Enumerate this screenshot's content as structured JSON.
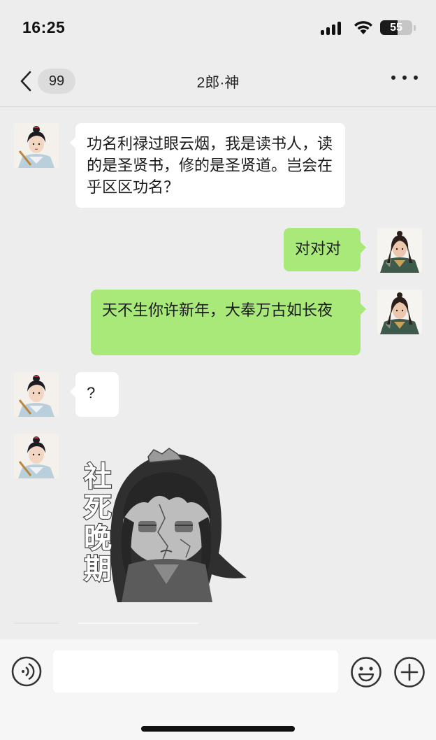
{
  "status": {
    "time": "16:25",
    "battery_level": "55",
    "battery_fraction": 0.55
  },
  "nav": {
    "unread_count": "99",
    "title": "2郎·神"
  },
  "messages": [
    {
      "side": "left",
      "avatar": "scholar-avatar",
      "text": "功名利禄过眼云烟，我是读书人，读的是圣贤书，修的是圣贤道。岂会在乎区区功名？"
    },
    {
      "side": "right",
      "avatar": "swordsman-avatar",
      "text": "对对对"
    },
    {
      "side": "right",
      "avatar": "swordsman-avatar",
      "text": "天不生你许新年，大奉万古如长夜"
    },
    {
      "side": "left",
      "avatar": "scholar-avatar",
      "text": "?"
    },
    {
      "side": "left",
      "avatar": "scholar-avatar",
      "sticker": {
        "caption": "社死晚期",
        "icon": "grayscale-chibi-sticker"
      }
    }
  ],
  "input": {
    "value": "",
    "placeholder": ""
  },
  "icons": {
    "back": "chevron-left-icon",
    "more": "more-dots-icon",
    "voice": "voice-icon",
    "emoji": "emoji-icon",
    "plus": "plus-icon"
  },
  "colors": {
    "background": "#ededed",
    "bubble_self": "#a9e97a",
    "bubble_other": "#ffffff"
  }
}
